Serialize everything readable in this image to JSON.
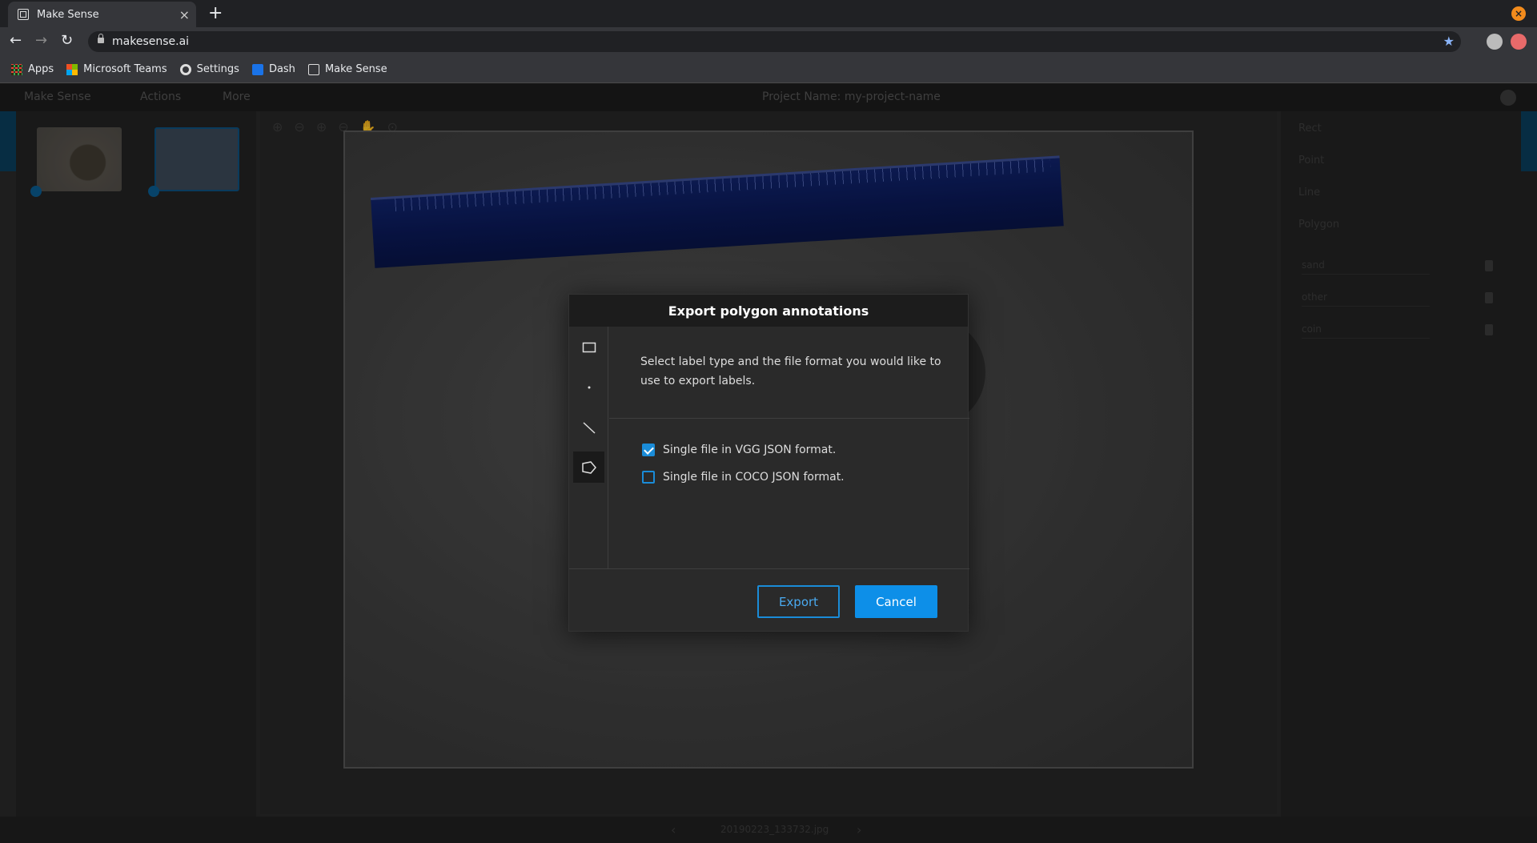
{
  "browser": {
    "tab_title": "Make Sense",
    "tab_close": "×",
    "new_tab": "+",
    "url": "makesense.ai",
    "bookmarks": [
      "Apps",
      "Microsoft Teams",
      "Settings",
      "Dash",
      "Make Sense"
    ]
  },
  "app": {
    "brand": "Make Sense",
    "menu_actions": "Actions",
    "menu_more": "More",
    "project_label": "Project Name:",
    "project_value": "my-project-name",
    "label_tools": [
      "Rect",
      "Point",
      "Line",
      "Polygon"
    ],
    "labels": [
      "sand",
      "other",
      "coin"
    ],
    "filename": "20190223_133732.jpg"
  },
  "modal": {
    "title": "Export polygon annotations",
    "description": "Select label type and the file format you would like to use to export labels.",
    "options": [
      {
        "label": "Single file in VGG JSON format.",
        "checked": true
      },
      {
        "label": "Single file in COCO JSON format.",
        "checked": false
      }
    ],
    "export_label": "Export",
    "cancel_label": "Cancel"
  },
  "colors": {
    "accent": "#0d8fe8",
    "modal_bg": "#2a2a2a",
    "header_bg": "#1c1c1c"
  }
}
